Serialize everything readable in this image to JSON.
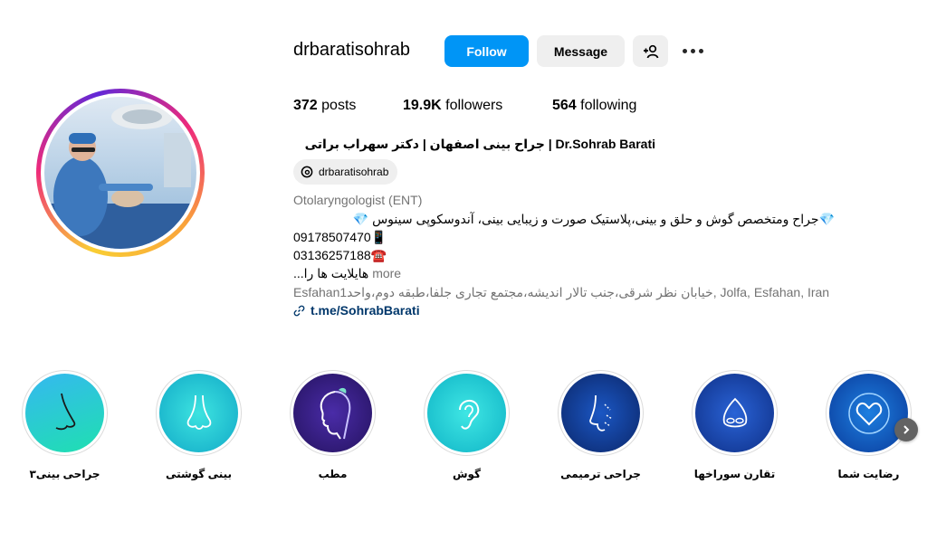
{
  "profile": {
    "username": "drbaratisohrab",
    "full_name": "Dr.Sohrab Barati | جراح بینی اصفهان | دکتر سهراب براتی"
  },
  "actions": {
    "follow_label": "Follow",
    "message_label": "Message"
  },
  "stats": {
    "posts_count": "372",
    "posts_label": "posts",
    "followers_count": "19.9K",
    "followers_label": "followers",
    "following_count": "564",
    "following_label": "following"
  },
  "threads": {
    "handle": "drbaratisohrab"
  },
  "bio": {
    "category": "Otolaryngologist (ENT)",
    "line1": "💎جراح ومتخصص گوش و حلق و بینی،پلاستیک صورت و زیبایی بینی، آندوسکوپی سینوس 💎",
    "line2": "09178507470📱",
    "line3": "03136257188☎️",
    "line4": "هایلایت ها را...",
    "more_label": "more",
    "address": "Esfahan1خیابان نظر شرقی،جنب تالار اندیشه،مجتمع تجاری جلفا،طبقه دوم،واحد, Jolfa, Esfahan, Iran",
    "link": "t.me/SohrabBarati"
  },
  "highlights": [
    {
      "label": "جراحی بینی۳",
      "icon": "nose-profile-icon",
      "bg": "#1fd1c2"
    },
    {
      "label": "بینی گوشتی",
      "icon": "nose-front-icon",
      "bg": "#16c2c9"
    },
    {
      "label": "مطب",
      "icon": "face-profile-icon",
      "bg": "#3b1d8f"
    },
    {
      "label": "گوش",
      "icon": "ear-icon",
      "bg": "#19c6cc"
    },
    {
      "label": "جراحی ترمیمی",
      "icon": "face-surgery-icon",
      "bg": "#123e9c"
    },
    {
      "label": "تقارن سوراخها",
      "icon": "nostrils-icon",
      "bg": "#1440a8"
    },
    {
      "label": "رضایت شما",
      "icon": "heart-icon",
      "bg": "#0d57b8"
    }
  ]
}
